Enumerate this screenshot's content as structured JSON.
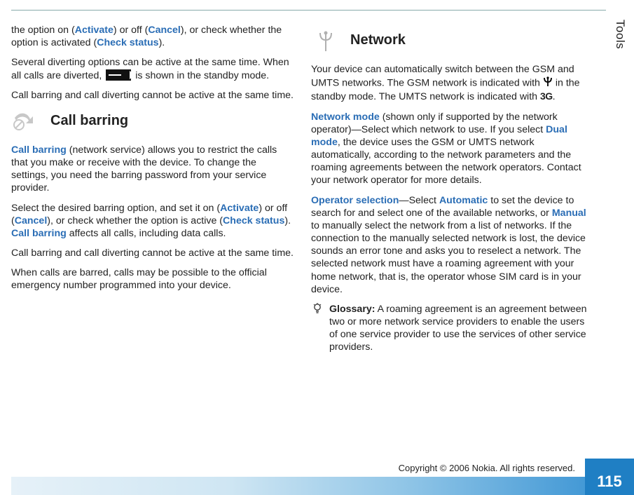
{
  "sideTab": "Tools",
  "left": {
    "p1a": "the option on (",
    "p1_activate": "Activate",
    "p1b": ") or off (",
    "p1_cancel": "Cancel",
    "p1c": "), or check whether the option is activated (",
    "p1_check": "Check status",
    "p1d": ").",
    "p2a": "Several diverting options can be active at the same time. When all calls are diverted, ",
    "p2b": " is shown in the standby mode.",
    "p3": "Call barring and call diverting cannot be active at the same time.",
    "h_callbarring": "Call barring",
    "p4_kw": "Call barring",
    "p4a": " (network service) allows you to restrict the calls that you make or receive with the device. To change the settings, you need the barring password from your service provider.",
    "p5a": "Select the desired barring option, and set it on (",
    "p5_activate": "Activate",
    "p5b": ") or off (",
    "p5_cancel": "Cancel",
    "p5c": "), or check whether the option is active (",
    "p5_check": "Check status",
    "p5d": "). ",
    "p5_kw2": "Call barring",
    "p5e": " affects all calls, including data calls.",
    "p6": "Call barring and call diverting cannot be active at the same time.",
    "p7": "When calls are barred, calls may be possible to the official emergency number programmed into your device."
  },
  "right": {
    "h_network": "Network",
    "p1a": "Your device can automatically switch between the GSM and UMTS networks. The GSM network is indicated with ",
    "p1b": " in the standby mode. The UMTS network is indicated with ",
    "p1_3g": "3G",
    "p1c": ".",
    "p2_kw": "Network mode",
    "p2a": " (shown only if supported by the network operator)—Select which network to use. If you select ",
    "p2_dual": "Dual mode",
    "p2b": ", the device uses the GSM or UMTS network automatically, according to the network parameters and the roaming agreements between the network operators. Contact your network operator for more details.",
    "p3_kw": "Operator selection",
    "p3a": "—Select ",
    "p3_auto": "Automatic",
    "p3b": " to set the device to search for and select one of the available networks, or ",
    "p3_manual": "Manual",
    "p3c": " to manually select the network from a list of networks. If the connection to the manually selected network is lost, the device sounds an error tone and asks you to reselect a network. The selected network must have a roaming agreement with your home network, that is, the operator whose SIM card is in your device.",
    "glossary_label": "Glossary:",
    "glossary_text": " A roaming agreement is an agreement between two or more network service providers to enable the users of one service provider to use the services of other service providers."
  },
  "footer": {
    "copyright": "Copyright © 2006 Nokia. All rights reserved.",
    "page": "115"
  }
}
